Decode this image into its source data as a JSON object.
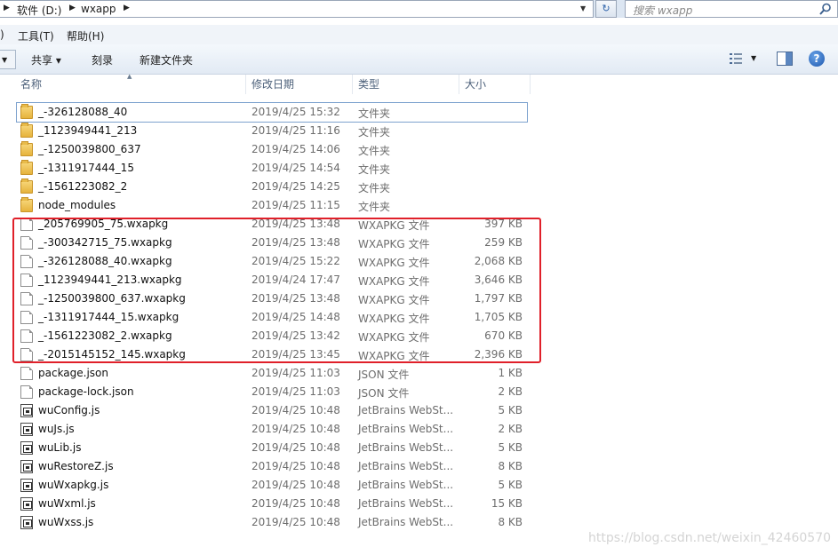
{
  "address": {
    "segments": [
      "软件 (D:)",
      "wxapp"
    ],
    "search_placeholder": "搜索 wxapp"
  },
  "menu": {
    "partial": ")",
    "tools": "工具(T)",
    "help": "帮助(H)"
  },
  "toolbar": {
    "share": "共享 ▾",
    "burn": "刻录",
    "new_folder": "新建文件夹"
  },
  "columns": {
    "name": "名称",
    "date": "修改日期",
    "type": "类型",
    "size": "大小"
  },
  "files": [
    {
      "name": "_-326128088_40",
      "date": "2019/4/25 15:32",
      "type": "文件夹",
      "size": "",
      "icon": "folder-icon"
    },
    {
      "name": "_1123949441_213",
      "date": "2019/4/25 11:16",
      "type": "文件夹",
      "size": "",
      "icon": "folder-icon"
    },
    {
      "name": "_-1250039800_637",
      "date": "2019/4/25 14:06",
      "type": "文件夹",
      "size": "",
      "icon": "folder-icon"
    },
    {
      "name": "_-1311917444_15",
      "date": "2019/4/25 14:54",
      "type": "文件夹",
      "size": "",
      "icon": "folder-icon"
    },
    {
      "name": "_-1561223082_2",
      "date": "2019/4/25 14:25",
      "type": "文件夹",
      "size": "",
      "icon": "folder-icon"
    },
    {
      "name": "node_modules",
      "date": "2019/4/25 11:15",
      "type": "文件夹",
      "size": "",
      "icon": "folder-icon"
    },
    {
      "name": "_205769905_75.wxapkg",
      "date": "2019/4/25 13:48",
      "type": "WXAPKG 文件",
      "size": "397 KB",
      "icon": "file-icon"
    },
    {
      "name": "_-300342715_75.wxapkg",
      "date": "2019/4/25 13:48",
      "type": "WXAPKG 文件",
      "size": "259 KB",
      "icon": "file-icon"
    },
    {
      "name": "_-326128088_40.wxapkg",
      "date": "2019/4/25 15:22",
      "type": "WXAPKG 文件",
      "size": "2,068 KB",
      "icon": "file-icon"
    },
    {
      "name": "_1123949441_213.wxapkg",
      "date": "2019/4/24 17:47",
      "type": "WXAPKG 文件",
      "size": "3,646 KB",
      "icon": "file-icon"
    },
    {
      "name": "_-1250039800_637.wxapkg",
      "date": "2019/4/25 13:48",
      "type": "WXAPKG 文件",
      "size": "1,797 KB",
      "icon": "file-icon"
    },
    {
      "name": "_-1311917444_15.wxapkg",
      "date": "2019/4/25 14:48",
      "type": "WXAPKG 文件",
      "size": "1,705 KB",
      "icon": "file-icon"
    },
    {
      "name": "_-1561223082_2.wxapkg",
      "date": "2019/4/25 13:42",
      "type": "WXAPKG 文件",
      "size": "670 KB",
      "icon": "file-icon"
    },
    {
      "name": "_-2015145152_145.wxapkg",
      "date": "2019/4/25 13:45",
      "type": "WXAPKG 文件",
      "size": "2,396 KB",
      "icon": "file-icon"
    },
    {
      "name": "package.json",
      "date": "2019/4/25 11:03",
      "type": "JSON 文件",
      "size": "1 KB",
      "icon": "file-icon"
    },
    {
      "name": "package-lock.json",
      "date": "2019/4/25 11:03",
      "type": "JSON 文件",
      "size": "2 KB",
      "icon": "file-icon"
    },
    {
      "name": "wuConfig.js",
      "date": "2019/4/25 10:48",
      "type": "JetBrains WebSt...",
      "size": "5 KB",
      "icon": "js-file-icon"
    },
    {
      "name": "wuJs.js",
      "date": "2019/4/25 10:48",
      "type": "JetBrains WebSt...",
      "size": "2 KB",
      "icon": "js-file-icon"
    },
    {
      "name": "wuLib.js",
      "date": "2019/4/25 10:48",
      "type": "JetBrains WebSt...",
      "size": "5 KB",
      "icon": "js-file-icon"
    },
    {
      "name": "wuRestoreZ.js",
      "date": "2019/4/25 10:48",
      "type": "JetBrains WebSt...",
      "size": "8 KB",
      "icon": "js-file-icon"
    },
    {
      "name": "wuWxapkg.js",
      "date": "2019/4/25 10:48",
      "type": "JetBrains WebSt...",
      "size": "5 KB",
      "icon": "js-file-icon"
    },
    {
      "name": "wuWxml.js",
      "date": "2019/4/25 10:48",
      "type": "JetBrains WebSt...",
      "size": "15 KB",
      "icon": "js-file-icon"
    },
    {
      "name": "wuWxss.js",
      "date": "2019/4/25 10:48",
      "type": "JetBrains WebSt...",
      "size": "8 KB",
      "icon": "js-file-icon"
    }
  ],
  "watermark": "https://blog.csdn.net/weixin_42460570",
  "colors": {
    "highlight": "#e0202a",
    "header_bg": "#dce6f2"
  }
}
